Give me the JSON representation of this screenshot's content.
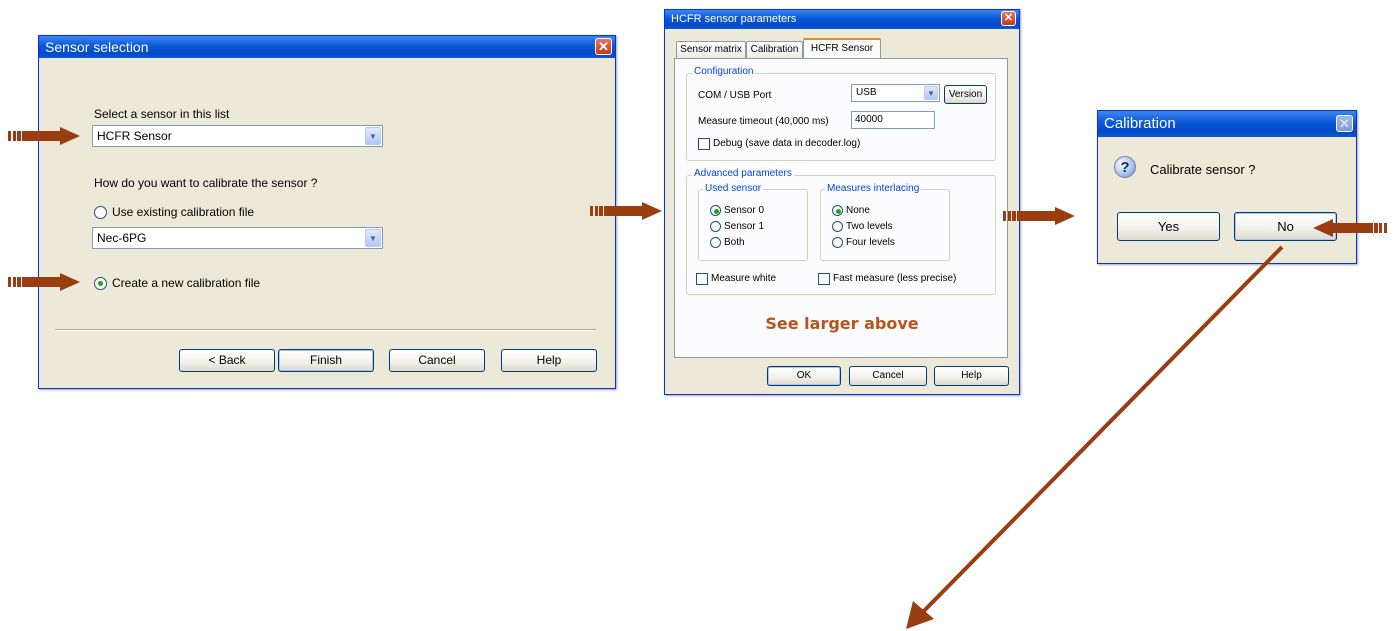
{
  "sensor_selection": {
    "title": "Sensor selection",
    "select_label": "Select a sensor in this list",
    "sensor_value": "HCFR Sensor",
    "calibrate_question": "How do you want to calibrate the sensor ?",
    "use_existing_label": "Use existing calibration file",
    "calibration_file_value": "Nec-6PG",
    "create_new_label": "Create a new calibration file",
    "create_new_selected": true,
    "buttons": {
      "back": "< Back",
      "finish": "Finish",
      "cancel": "Cancel",
      "help": "Help"
    }
  },
  "hcfr_params": {
    "title": "HCFR sensor parameters",
    "tabs": [
      "Sensor matrix",
      "Calibration",
      "HCFR Sensor"
    ],
    "active_tab": "HCFR Sensor",
    "configuration_label": "Configuration",
    "port_label": "COM / USB Port",
    "port_value": "USB",
    "version_button": "Version",
    "timeout_label": "Measure timeout (40,000 ms)",
    "timeout_value": "40000",
    "debug_label": "Debug (save data in decoder.log)",
    "advanced_label": "Advanced parameters",
    "used_sensor_label": "Used sensor",
    "sensor_options": [
      "Sensor 0",
      "Sensor 1",
      "Both"
    ],
    "interlacing_label": "Measures interlacing",
    "interlacing_options": [
      "None",
      "Two levels",
      "Four levels"
    ],
    "measure_white_label": "Measure white",
    "fast_measure_label": "Fast measure (less precise)",
    "note": "See larger above",
    "note_color": "#b5541c",
    "buttons": {
      "ok": "OK",
      "cancel": "Cancel",
      "help": "Help"
    }
  },
  "calibration_dialog": {
    "title": "Calibration",
    "message": "Calibrate sensor ?",
    "yes": "Yes",
    "no": "No"
  },
  "colors": {
    "arrow": "#9a3e12",
    "title_bar": "#0a58d6",
    "dialog_bg": "#ece9d8"
  }
}
